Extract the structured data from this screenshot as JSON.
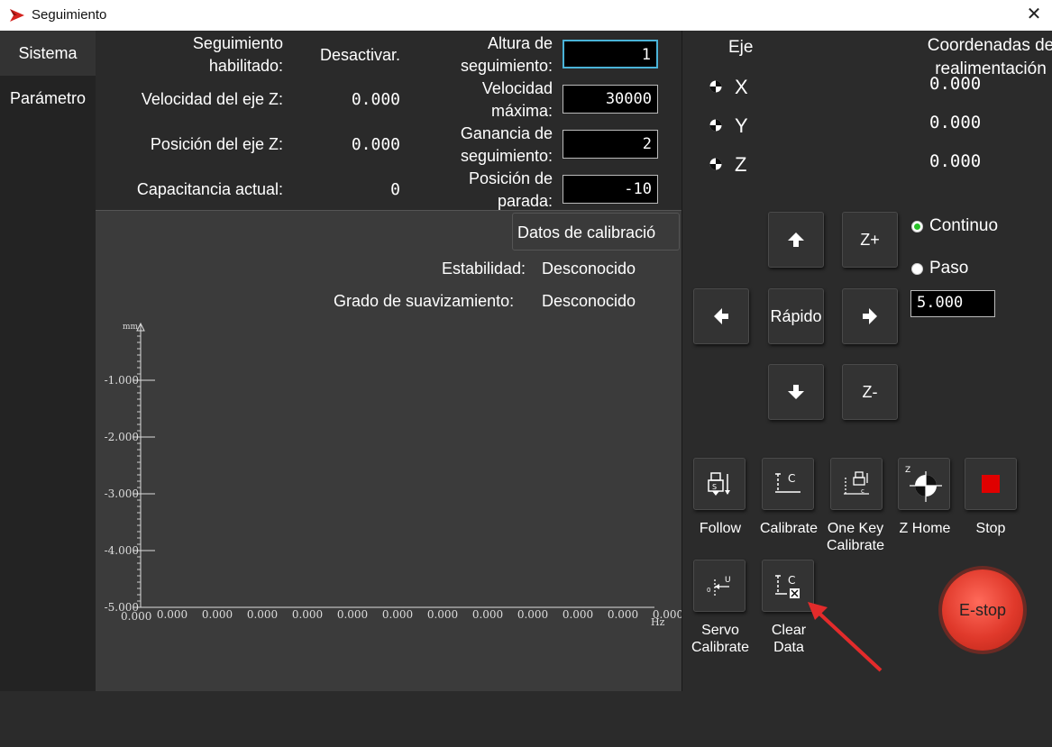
{
  "window": {
    "title": "Seguimiento"
  },
  "sidebar": {
    "items": [
      {
        "label": "Sistema"
      },
      {
        "label": "Parámetro"
      }
    ]
  },
  "info": {
    "follow_enabled_label_1": "Seguimiento",
    "follow_enabled_label_2": "habilitado:",
    "follow_enabled_value": "Desactivar.",
    "z_speed_label": "Velocidad del eje Z:",
    "z_speed_value": "0.000",
    "z_pos_label": "Posición del eje Z:",
    "z_pos_value": "0.000",
    "capacitance_label": "Capacitancia actual:",
    "capacitance_value": "0",
    "follow_height_label_1": "Altura de",
    "follow_height_label_2": "seguimiento:",
    "follow_height_value": "1",
    "max_speed_label_1": "Velocidad",
    "max_speed_label_2": "máxima:",
    "max_speed_value": "30000",
    "gain_label_1": "Ganancia de",
    "gain_label_2": "seguimiento:",
    "gain_value": "2",
    "stop_pos_label_1": "Posición de",
    "stop_pos_label_2": "parada:",
    "stop_pos_value": "-10"
  },
  "calibration": {
    "button_label": "Datos de calibració",
    "stability_label": "Estabilidad:",
    "stability_value": "Desconocido",
    "smoothing_label": "Grado de suavizamiento:",
    "smoothing_value": "Desconocido"
  },
  "chart_data": {
    "type": "line",
    "ylabel": "mm",
    "xlabel": "Hz",
    "y_ticks": [
      "-1.000",
      "-2.000",
      "-3.000",
      "-4.000",
      "-5.000"
    ],
    "x_ticks": [
      "0.000",
      "0.000",
      "0.000",
      "0.000",
      "0.000",
      "0.000",
      "0.000",
      "0.000",
      "0.000",
      "0.000",
      "0.000",
      "0.000"
    ],
    "origin_label": "0.000",
    "ylim": [
      -5,
      0
    ],
    "series": []
  },
  "axes": {
    "header_axis": "Eje",
    "header_coord_1": "Coordenadas de",
    "header_coord_2": "realimentación",
    "rows": [
      {
        "name": "X",
        "value": "0.000"
      },
      {
        "name": "Y",
        "value": "0.000"
      },
      {
        "name": "Z",
        "value": "0.000"
      }
    ]
  },
  "jog": {
    "zplus": "Z+",
    "zminus": "Z-",
    "rapid": "Rápido",
    "mode_continuous": "Continuo",
    "mode_step": "Paso",
    "step_value": "5.000"
  },
  "tools": [
    {
      "label": "Follow",
      "icon": "follow-icon"
    },
    {
      "label": "Calibrate",
      "icon": "calibrate-icon"
    },
    {
      "label_1": "One Key",
      "label_2": "Calibrate",
      "icon": "one-key-calibrate-icon"
    },
    {
      "label": "Z Home",
      "icon": "z-home-icon"
    },
    {
      "label": "Stop",
      "icon": "stop-icon"
    },
    {
      "label_1": "Servo",
      "label_2": "Calibrate",
      "icon": "servo-calibrate-icon"
    },
    {
      "label_1": "Clear",
      "label_2": "Data",
      "icon": "clear-data-icon"
    }
  ],
  "estop": {
    "label": "E-stop"
  },
  "colors": {
    "accent_focus": "#4ab3d8",
    "stop_red": "#e00000",
    "estop_red": "#e0392b",
    "radio_green": "#27c127",
    "arrow_annotation": "#e32b2b"
  }
}
